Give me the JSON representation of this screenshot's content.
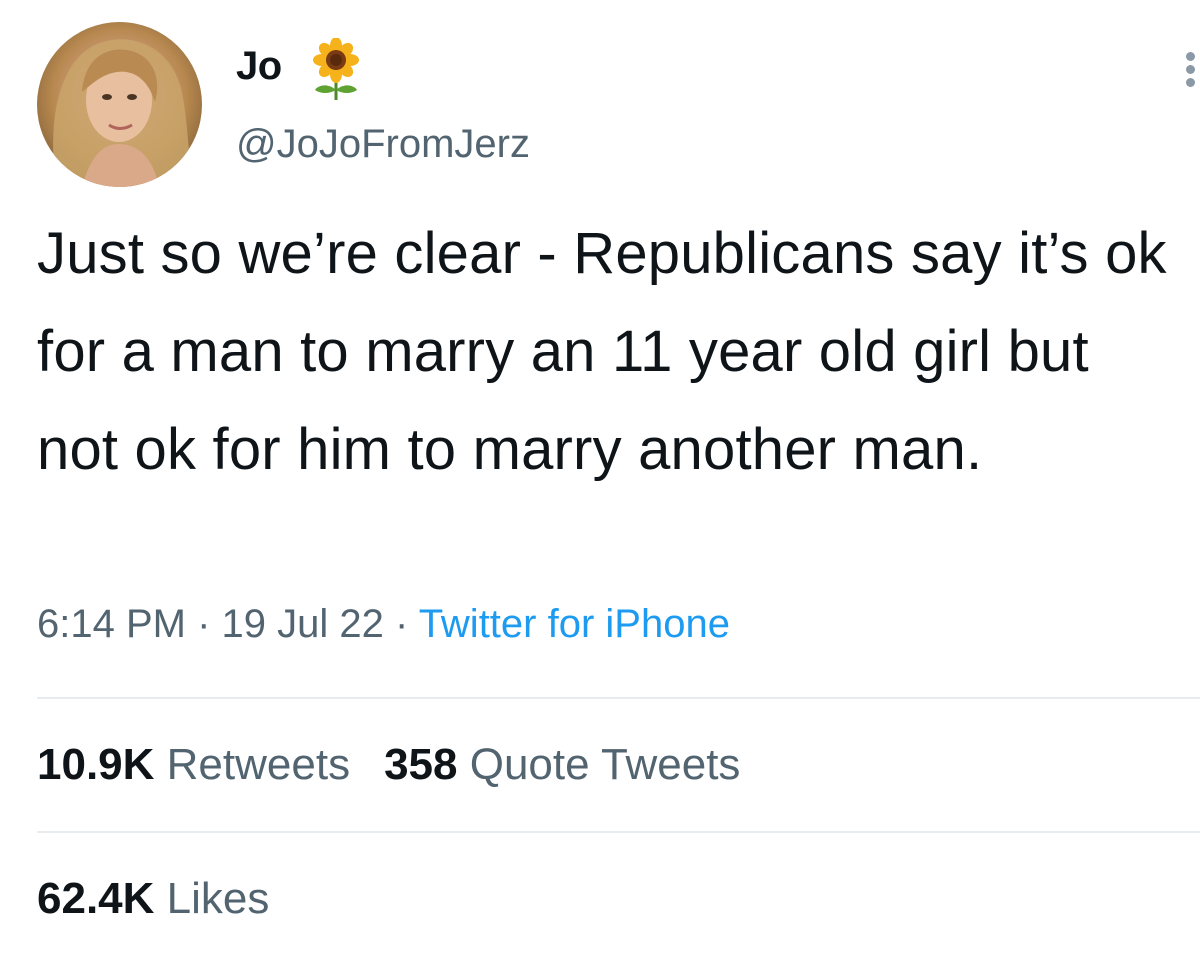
{
  "author": {
    "display_name": "Jo",
    "name_emoji": "sunflower-icon",
    "handle": "@JoJoFromJerz"
  },
  "tweet": {
    "text": "Just so we’re clear - Republicans say it’s ok for a man to marry an 11 year old girl but not ok for him to marry another man."
  },
  "meta": {
    "time": "6:14 PM",
    "separator": " · ",
    "date": "19 Jul 22",
    "source": "Twitter for iPhone"
  },
  "stats": {
    "retweets_count": "10.9K",
    "retweets_label": "Retweets",
    "quotes_count": "358",
    "quotes_label": "Quote Tweets",
    "likes_count": "62.4K",
    "likes_label": "Likes"
  },
  "colors": {
    "text": "#0f1419",
    "secondary": "#536471",
    "link": "#1d9bf0",
    "divider": "#e6ecf0"
  }
}
